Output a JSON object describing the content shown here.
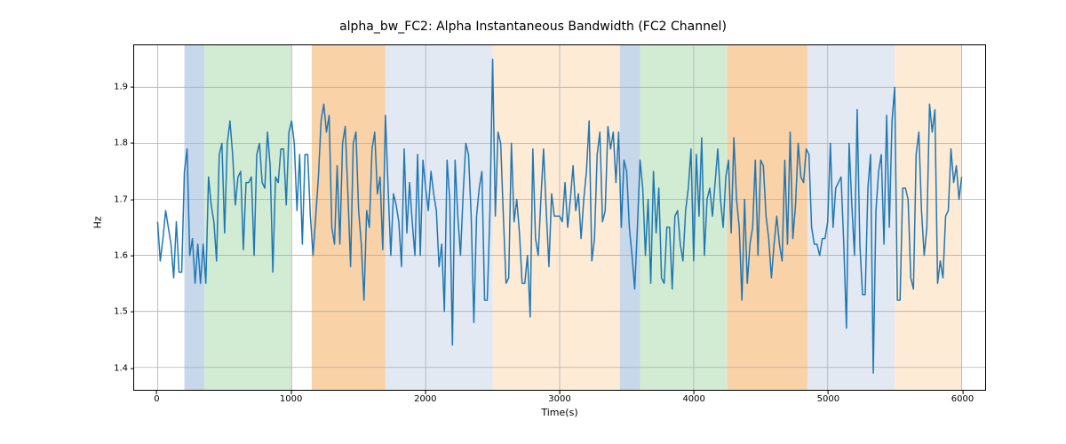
{
  "chart_data": {
    "type": "line",
    "title": "alpha_bw_FC2: Alpha Instantaneous Bandwidth (FC2 Channel)",
    "xlabel": "Time(s)",
    "ylabel": "Hz",
    "xlim": [
      -175,
      6175
    ],
    "ylim": [
      1.36,
      1.975
    ],
    "x_ticks": [
      0,
      1000,
      2000,
      3000,
      4000,
      5000,
      6000
    ],
    "y_ticks": [
      1.4,
      1.5,
      1.6,
      1.7,
      1.8,
      1.9
    ],
    "regions": [
      {
        "start": 200,
        "end": 350,
        "color": "#c7d8ea"
      },
      {
        "start": 350,
        "end": 1000,
        "color": "#d2ecd3"
      },
      {
        "start": 1150,
        "end": 1700,
        "color": "#fad2a7"
      },
      {
        "start": 1700,
        "end": 2500,
        "color": "#fdebd5"
      },
      {
        "start": 2500,
        "end": 3450,
        "color": "#fdebd5"
      },
      {
        "start": 1700,
        "end": 2500,
        "color": "#e2e9f3"
      },
      {
        "start": 3450,
        "end": 3600,
        "color": "#c7d8ea"
      },
      {
        "start": 3600,
        "end": 4250,
        "color": "#d2ecd3"
      },
      {
        "start": 4250,
        "end": 4850,
        "color": "#fad2a7"
      },
      {
        "start": 4850,
        "end": 5500,
        "color": "#e2e9f3"
      },
      {
        "start": 5500,
        "end": 6000,
        "color": "#fdebd5"
      }
    ],
    "series": [
      {
        "name": "alpha_bw_FC2",
        "color": "#1f77b4",
        "x_step": 20,
        "x_start": 0,
        "values": [
          1.66,
          1.59,
          1.63,
          1.68,
          1.65,
          1.62,
          1.56,
          1.66,
          1.57,
          1.57,
          1.75,
          1.79,
          1.6,
          1.63,
          1.55,
          1.62,
          1.55,
          1.62,
          1.55,
          1.74,
          1.69,
          1.66,
          1.59,
          1.78,
          1.8,
          1.64,
          1.8,
          1.84,
          1.78,
          1.69,
          1.74,
          1.75,
          1.61,
          1.73,
          1.73,
          1.74,
          1.6,
          1.78,
          1.8,
          1.73,
          1.72,
          1.82,
          1.76,
          1.57,
          1.74,
          1.73,
          1.79,
          1.79,
          1.69,
          1.82,
          1.84,
          1.8,
          1.68,
          1.78,
          1.62,
          1.78,
          1.78,
          1.67,
          1.6,
          1.67,
          1.74,
          1.84,
          1.87,
          1.82,
          1.85,
          1.65,
          1.62,
          1.76,
          1.62,
          1.8,
          1.83,
          1.71,
          1.58,
          1.8,
          1.82,
          1.68,
          1.62,
          1.52,
          1.68,
          1.65,
          1.79,
          1.82,
          1.71,
          1.74,
          1.61,
          1.85,
          1.72,
          1.6,
          1.71,
          1.69,
          1.66,
          1.58,
          1.79,
          1.64,
          1.73,
          1.66,
          1.6,
          1.78,
          1.6,
          1.77,
          1.72,
          1.68,
          1.75,
          1.71,
          1.68,
          1.58,
          1.62,
          1.5,
          1.77,
          1.7,
          1.44,
          1.77,
          1.67,
          1.6,
          1.71,
          1.8,
          1.78,
          1.67,
          1.48,
          1.67,
          1.72,
          1.75,
          1.52,
          1.52,
          1.68,
          1.95,
          1.67,
          1.82,
          1.8,
          1.67,
          1.55,
          1.56,
          1.8,
          1.66,
          1.7,
          1.64,
          1.55,
          1.55,
          1.6,
          1.49,
          1.79,
          1.63,
          1.6,
          1.7,
          1.79,
          1.68,
          1.58,
          1.71,
          1.67,
          1.67,
          1.67,
          1.66,
          1.73,
          1.65,
          1.7,
          1.76,
          1.68,
          1.71,
          1.63,
          1.7,
          1.75,
          1.84,
          1.59,
          1.63,
          1.78,
          1.82,
          1.66,
          1.68,
          1.83,
          1.79,
          1.82,
          1.73,
          1.82,
          1.65,
          1.77,
          1.75,
          1.65,
          1.6,
          1.54,
          1.65,
          1.77,
          1.72,
          1.6,
          1.7,
          1.55,
          1.75,
          1.64,
          1.72,
          1.56,
          1.55,
          1.65,
          1.65,
          1.54,
          1.67,
          1.68,
          1.62,
          1.59,
          1.68,
          1.72,
          1.79,
          1.59,
          1.78,
          1.67,
          1.81,
          1.6,
          1.7,
          1.72,
          1.67,
          1.73,
          1.79,
          1.7,
          1.65,
          1.74,
          1.77,
          1.64,
          1.81,
          1.7,
          1.65,
          1.52,
          1.7,
          1.55,
          1.62,
          1.65,
          1.77,
          1.6,
          1.77,
          1.76,
          1.67,
          1.63,
          1.56,
          1.62,
          1.67,
          1.62,
          1.59,
          1.77,
          1.62,
          1.82,
          1.63,
          1.69,
          1.8,
          1.74,
          1.73,
          1.79,
          1.78,
          1.65,
          1.62,
          1.62,
          1.6,
          1.63,
          1.63,
          1.66,
          1.8,
          1.65,
          1.72,
          1.73,
          1.74,
          1.62,
          1.47,
          1.8,
          1.69,
          1.6,
          1.86,
          1.62,
          1.53,
          1.53,
          1.72,
          1.78,
          1.39,
          1.68,
          1.75,
          1.78,
          1.62,
          1.85,
          1.65,
          1.84,
          1.9,
          1.52,
          1.52,
          1.72,
          1.72,
          1.7,
          1.56,
          1.54,
          1.78,
          1.82,
          1.68,
          1.6,
          1.65,
          1.87,
          1.82,
          1.86,
          1.55,
          1.59,
          1.56,
          1.67,
          1.68,
          1.79,
          1.73,
          1.76,
          1.7,
          1.74
        ]
      }
    ]
  }
}
